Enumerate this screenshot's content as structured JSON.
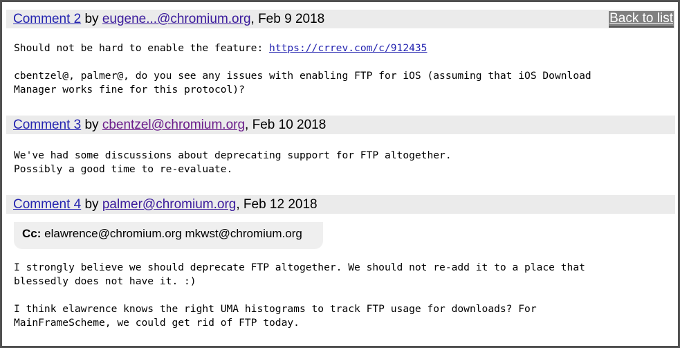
{
  "back_link": "Back to list",
  "by_label": "by",
  "comments": [
    {
      "link": "Comment 2",
      "author": "eugene...@chromium.org",
      "date": ", Feb 9 2018",
      "paragraphs": [
        {
          "text": "Should not be hard to enable the feature: ",
          "link": "https://crrev.com/c/912435"
        },
        {
          "text": "cbentzel@, palmer@, do you see any issues with enabling FTP for iOS (assuming that iOS Download\nManager works fine for this protocol)?"
        }
      ]
    },
    {
      "link": "Comment 3",
      "author": "cbentzel@chromium.org",
      "date": ", Feb 10 2018",
      "paragraphs": [
        {
          "text": "We've had some discussions about deprecating support for FTP altogether.\nPossibly a good time to re-evaluate."
        }
      ]
    },
    {
      "link": "Comment 4",
      "author": "palmer@chromium.org",
      "date": ", Feb 12 2018",
      "cc_label": "Cc:",
      "cc_value": " elawrence@chromium.org mkwst@chromium.org",
      "paragraphs": [
        {
          "text": "I strongly believe we should deprecate FTP altogether. We should not re-add it to a place that\nblessedly does not have it. :)"
        },
        {
          "text": "I think elawrence knows the right UMA histograms to track FTP usage for downloads? For\nMainFrameScheme, we could get rid of FTP today."
        }
      ]
    }
  ]
}
